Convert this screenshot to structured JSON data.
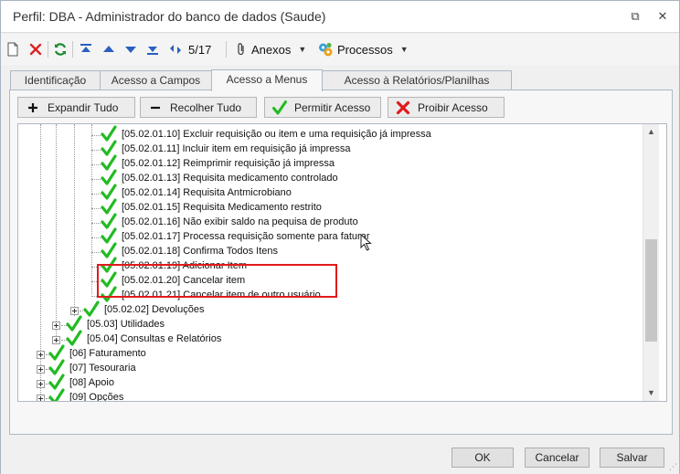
{
  "window": {
    "title": "Perfil: DBA - Administrador do banco de dados (Saude)",
    "restore_glyph": "⧉",
    "close_glyph": "✕"
  },
  "toolbar": {
    "counter": "5/17",
    "anexos_label": "Anexos",
    "processos_label": "Processos",
    "caret": "▼"
  },
  "tabs": [
    {
      "label": "Identificação"
    },
    {
      "label": "Acesso a Campos"
    },
    {
      "label": "Acesso a Menus"
    },
    {
      "label": "Acesso à Relatórios/Planilhas"
    }
  ],
  "actions": {
    "expand_label": "Expandir Tudo",
    "collapse_label": "Recolher Tudo",
    "allow_label": "Permitir Acesso",
    "deny_label": "Proibir Acesso"
  },
  "tree": {
    "items": [
      {
        "label": "[05.02.01.10] Excluir requisição ou item e uma requisição já impressa"
      },
      {
        "label": "[05.02.01.11] Incluir item em requisição já impressa"
      },
      {
        "label": "[05.02.01.12] Reimprimir requisição já impressa"
      },
      {
        "label": "[05.02.01.13] Requisita medicamento controlado"
      },
      {
        "label": "[05.02.01.14] Requisita Antmicrobiano"
      },
      {
        "label": "[05.02.01.15] Requisita Medicamento restrito"
      },
      {
        "label": "[05.02.01.16] Não exibir saldo na pequisa de produto"
      },
      {
        "label": "[05.02.01.17] Processa requisição somente para faturar"
      },
      {
        "label": "[05.02.01.18] Confirma Todos Itens"
      },
      {
        "label": "[05.02.01.19] Adicionar Item"
      },
      {
        "label": "[05.02.01.20] Cancelar item"
      },
      {
        "label": "[05.02.01.21] Cancelar item de outro usuário"
      },
      {
        "label": "[05.02.02] Devoluções"
      },
      {
        "label": "[05.03] Utilidades"
      },
      {
        "label": "[05.04] Consultas e Relatórios"
      },
      {
        "label": "[06] Faturamento"
      },
      {
        "label": "[07] Tesouraria"
      },
      {
        "label": "[08] Apoio"
      },
      {
        "label": "[09] Opções"
      }
    ]
  },
  "scroll": {
    "up": "▲",
    "down": "▼"
  },
  "footer": {
    "ok_label": "OK",
    "cancel_label": "Cancelar",
    "save_label": "Salvar"
  },
  "colors": {
    "check": "#22bb22",
    "highlight": "#e01b1b",
    "nav_blue": "#2a5fc0"
  }
}
